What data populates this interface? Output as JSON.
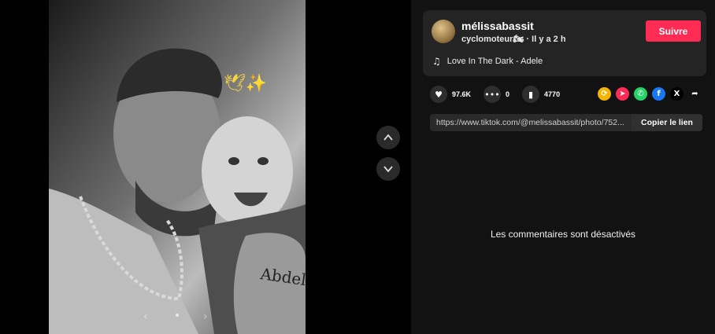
{
  "post": {
    "username": "mélissabassit",
    "subtitle": "cyclomoteur🏍 · Il y a 2 h",
    "follow_label": "Suivre",
    "music": "Love In The Dark - Adele",
    "image_text": {
      "sticker": "🕊✨",
      "tattoo": "Abdel"
    }
  },
  "stats": {
    "likes": "97.6K",
    "comments": "0",
    "saves": "4770"
  },
  "share": {
    "icons": [
      "repost-icon",
      "send-icon",
      "whatsapp-icon",
      "facebook-icon",
      "x-icon",
      "share-arrow-icon"
    ],
    "link": "https://www.tiktok.com/@melissabassit/photo/752...",
    "copy_label": "Copier le lien"
  },
  "comments": {
    "disabled_text": "Les commentaires sont désactivés"
  },
  "colors": {
    "accent": "#fe2c55",
    "panel": "#121212",
    "card": "#242424"
  }
}
